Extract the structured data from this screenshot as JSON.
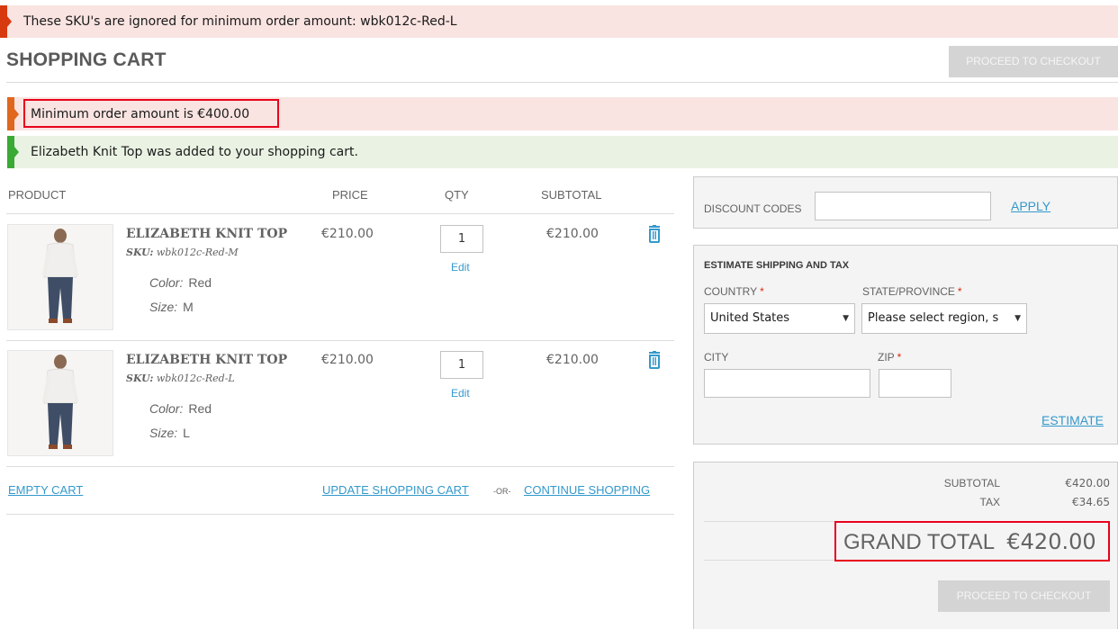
{
  "messages": {
    "sku_notice": "These SKU's are ignored for minimum order amount: wbk012c-Red-L",
    "min_order": "Minimum order amount is €400.00",
    "added": "Elizabeth Knit Top was added to your shopping cart."
  },
  "colors": {
    "accent": "#3399cc",
    "error_flag": "#d83a0f",
    "warning_flag": "#e0671e",
    "success_flag": "#3aaa35",
    "highlight": "#e8001c"
  },
  "header": {
    "title": "SHOPPING CART",
    "checkout_label": "PROCEED TO CHECKOUT"
  },
  "cart": {
    "columns": [
      "PRODUCT",
      "PRICE",
      "QTY",
      "SUBTOTAL"
    ],
    "items": [
      {
        "name": "ELIZABETH KNIT TOP",
        "sku_label": "SKU:",
        "sku": "wbk012c-Red-M",
        "color_label": "Color:",
        "color": "Red",
        "size_label": "Size:",
        "size": "M",
        "price": "€210.00",
        "qty": "1",
        "edit": "Edit",
        "subtotal": "€210.00"
      },
      {
        "name": "ELIZABETH KNIT TOP",
        "sku_label": "SKU:",
        "sku": "wbk012c-Red-L",
        "color_label": "Color:",
        "color": "Red",
        "size_label": "Size:",
        "size": "L",
        "price": "€210.00",
        "qty": "1",
        "edit": "Edit",
        "subtotal": "€210.00"
      }
    ],
    "actions": {
      "empty": "EMPTY CART",
      "update": "UPDATE SHOPPING CART",
      "or": "-OR-",
      "continue": "CONTINUE SHOPPING"
    }
  },
  "discount": {
    "label": "DISCOUNT CODES",
    "apply": "APPLY"
  },
  "shipping": {
    "title": "ESTIMATE SHIPPING AND TAX",
    "country_label": "COUNTRY",
    "country_value": "United States",
    "state_label": "STATE/PROVINCE",
    "state_value": "Please select region, s",
    "city_label": "CITY",
    "zip_label": "ZIP",
    "required_mark": "*",
    "estimate": "ESTIMATE"
  },
  "totals": {
    "subtotal_label": "SUBTOTAL",
    "subtotal": "€420.00",
    "tax_label": "TAX",
    "tax": "€34.65",
    "grand_label": "GRAND TOTAL",
    "grand": "€420.00",
    "checkout_label": "PROCEED TO CHECKOUT"
  }
}
